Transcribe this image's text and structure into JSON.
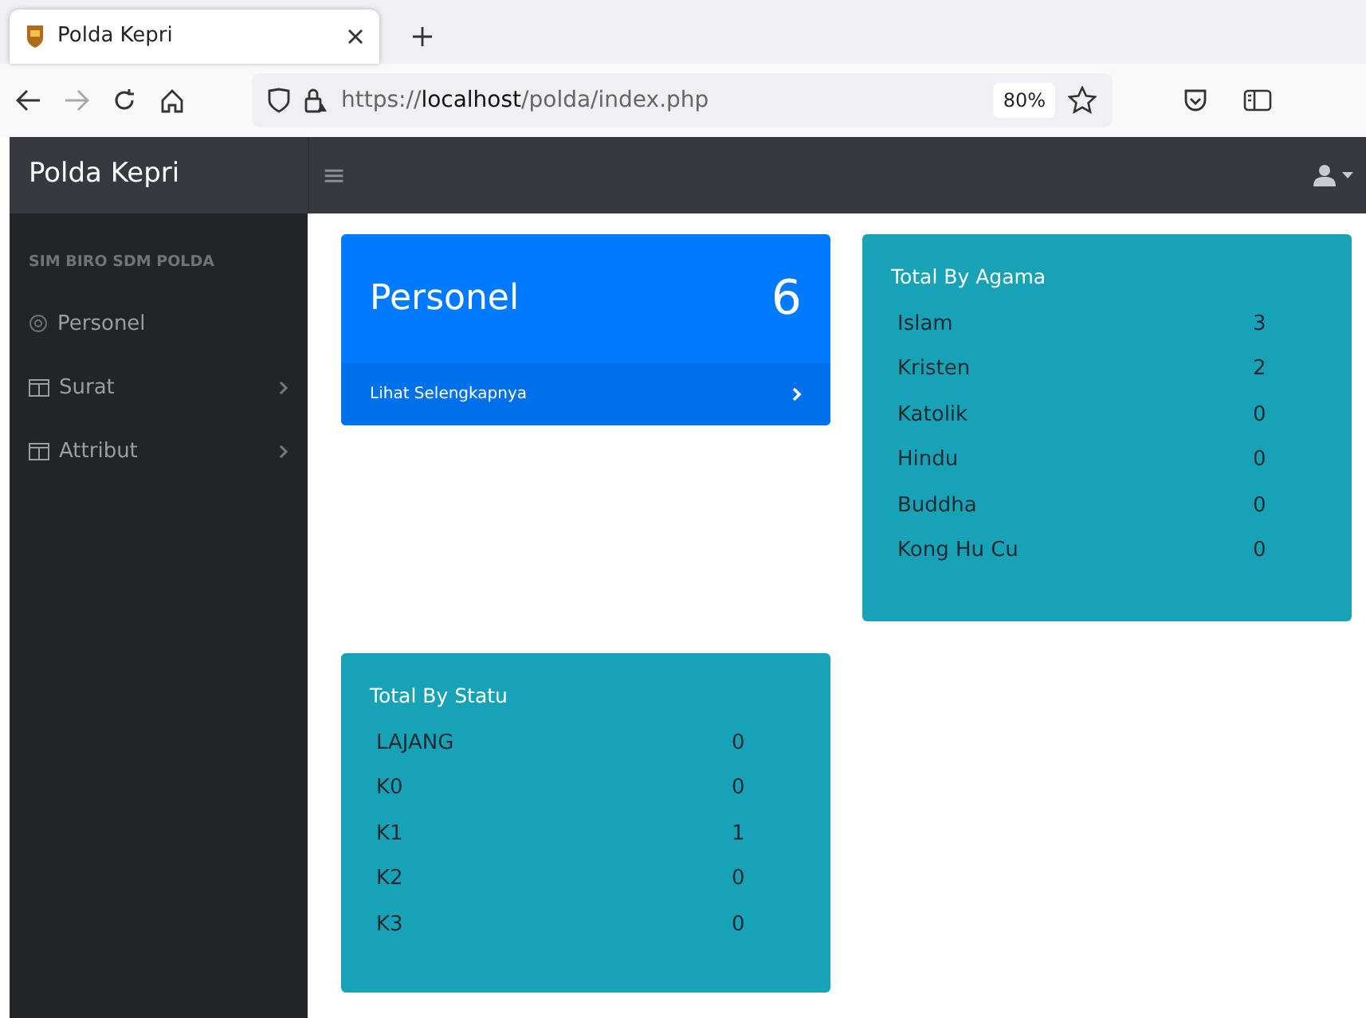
{
  "browser": {
    "tab_title": "Polda Kepri",
    "url_scheme": "https://",
    "url_host": "localhost",
    "url_path": "/polda/index.php",
    "zoom": "80%"
  },
  "navbar": {
    "brand": "Polda Kepri",
    "menu_glyph": "≡"
  },
  "sidebar": {
    "heading": "SIM BIRO SDM POLDA",
    "items": [
      {
        "label": "Personel",
        "kind": "link"
      },
      {
        "label": "Surat",
        "kind": "group"
      },
      {
        "label": "Attribut",
        "kind": "group"
      }
    ]
  },
  "personel_card": {
    "title": "Personel",
    "count": "6",
    "footer": "Lihat Selengkapnya"
  },
  "agama_card": {
    "title": "Total By Agama",
    "rows": [
      {
        "label": "Islam",
        "value": "3"
      },
      {
        "label": "Kristen",
        "value": "2"
      },
      {
        "label": "Katolik",
        "value": "0"
      },
      {
        "label": "Hindu",
        "value": "0"
      },
      {
        "label": "Buddha",
        "value": "0"
      },
      {
        "label": "Kong Hu Cu",
        "value": "0"
      }
    ]
  },
  "status_card": {
    "title": "Total By Statu",
    "rows": [
      {
        "label": "LAJANG",
        "value": "0"
      },
      {
        "label": "K0",
        "value": "0"
      },
      {
        "label": "K1",
        "value": "1"
      },
      {
        "label": "K2",
        "value": "0"
      },
      {
        "label": "K3",
        "value": "0"
      }
    ]
  }
}
